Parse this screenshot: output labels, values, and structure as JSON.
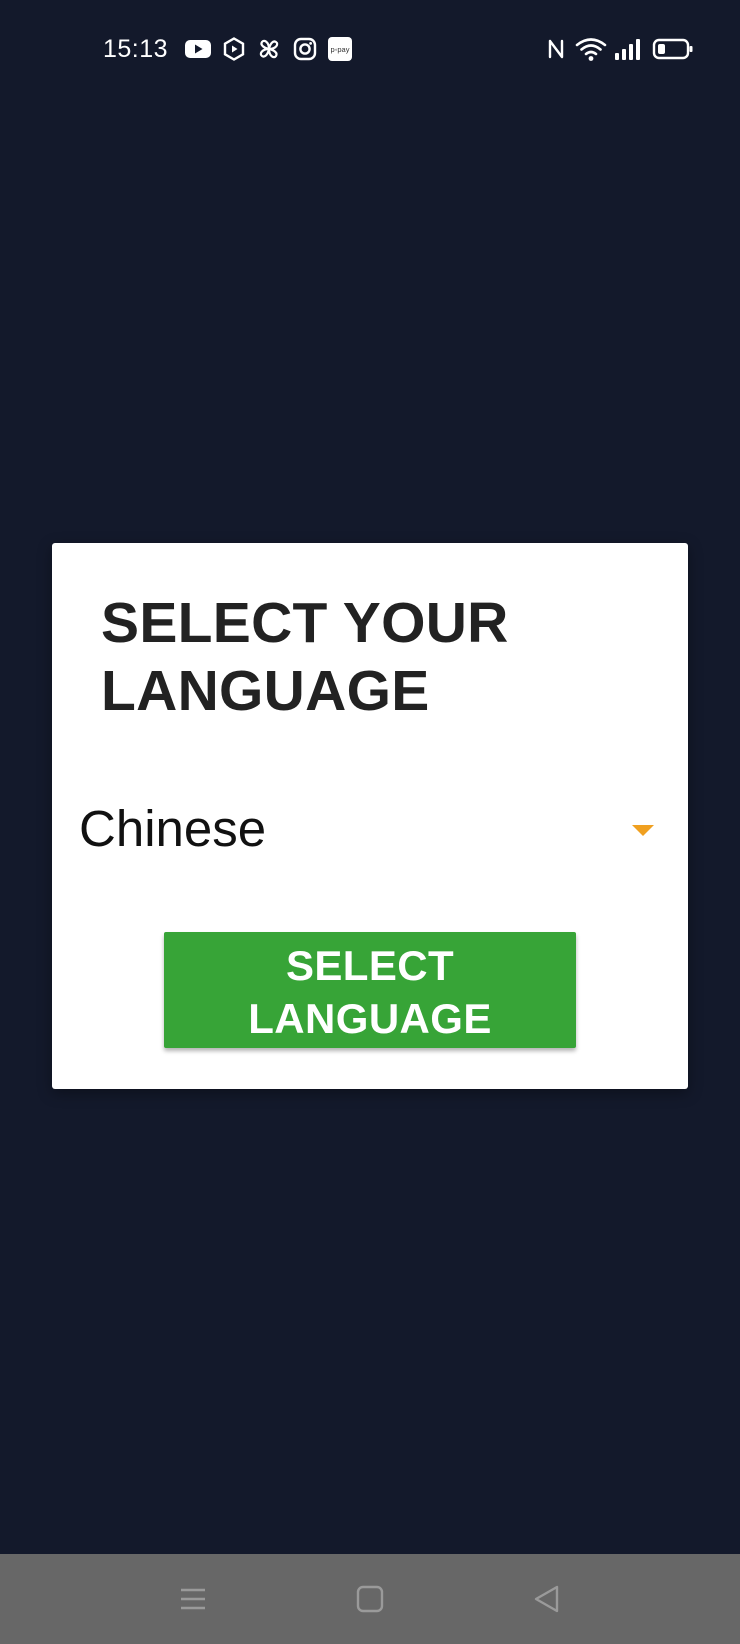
{
  "status_bar": {
    "time": "15:13",
    "notification_icons": [
      "youtube-icon",
      "hexagon-play-icon",
      "pinwheel-icon",
      "instagram-icon",
      "paypay-icon"
    ],
    "paypay_label": "p◦pay",
    "system_icons": [
      "nfc-icon",
      "wifi-icon",
      "signal-icon",
      "battery-icon"
    ]
  },
  "dialog": {
    "title_line1": "SELECT YOUR",
    "title_line2": "LANGUAGE",
    "selected_language": "Chinese",
    "button_line1": "SELECT",
    "button_line2": "LANGUAGE"
  },
  "nav_bar": {
    "buttons": [
      "menu-icon",
      "home-icon",
      "back-icon"
    ]
  },
  "colors": {
    "background": "#13192b",
    "dialog_bg": "#ffffff",
    "button": "#37a437",
    "dropdown_arrow": "#f0a020",
    "nav_bar": "#676767"
  }
}
